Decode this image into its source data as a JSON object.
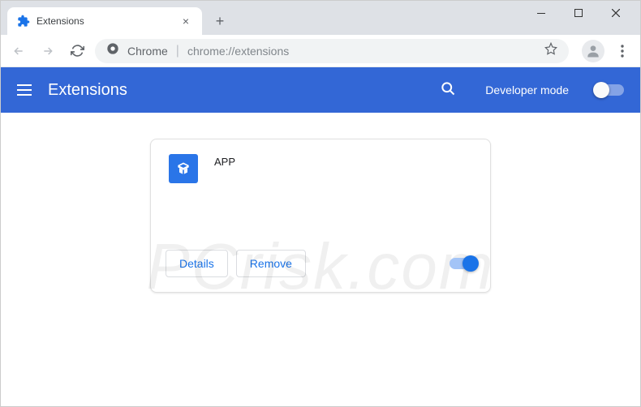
{
  "window": {
    "tab_title": "Extensions"
  },
  "address": {
    "scheme_label": "Chrome",
    "url": "chrome://extensions"
  },
  "header": {
    "title": "Extensions",
    "dev_mode_label": "Developer mode"
  },
  "extension": {
    "name": "APP",
    "details_label": "Details",
    "remove_label": "Remove",
    "enabled": true
  },
  "watermark": "PCrisk.com"
}
